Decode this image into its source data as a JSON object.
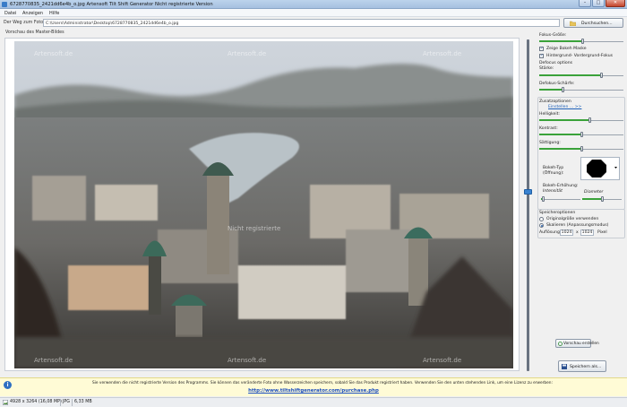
{
  "window": {
    "title": "6728770835_2421dd6e4b_o.jpg Artensoft Tilt Shift Generator  Nicht registrierte Version",
    "controls": [
      "–",
      "□",
      "✕"
    ]
  },
  "menu": [
    "Datei",
    "Anzeigen",
    "Hilfe"
  ],
  "path": {
    "label": "Der Weg zum Foto:",
    "value": "C:\\Users\\Administrator\\Desktop\\6728770835_2421dd6e4b_o.jpg",
    "browse_label": "Durchsuchen..."
  },
  "preview": {
    "label": "Vorschau des Master-Bildes",
    "watermarks": [
      "Artensoft.de",
      "Artensoft.de",
      "Artensoft.de",
      "Nicht registrierte",
      "Artensoft.de",
      "Artensoft.de",
      "Artensoft.de"
    ]
  },
  "panel": {
    "focus_size_label": "Fokus-Größe:",
    "focus_size": 0.52,
    "show_bokeh_mask": "Zeige Bokeh Maske",
    "fg_bg_focus": "Hintergrund- Vordergrund-Fokus",
    "defocus_options_label": "Defocus options",
    "strength_label": "Stärke:",
    "strength": 0.74,
    "defocus_sharpness_label": "Defokus-Schärfe:",
    "defocus_sharpness": 0.28,
    "extra_options_label": "Zusatzoptionen",
    "adjust_link": "Einstellen ... >>",
    "brightness_label": "Helligkeit:",
    "brightness": 0.6,
    "contrast_label": "Kontrast:",
    "contrast": 0.5,
    "saturation_label": "Sättigung:",
    "saturation": 0.5,
    "bokeh_type_label": "Bokeh-Typ",
    "bokeh_opening_label": "(Öffnung):",
    "bokeh_boost_label": "Bokeh-Erhöhung:",
    "intensity_label": "Intensität",
    "diameter_label": "Diameter",
    "bokeh_intensity": 0.05,
    "bokeh_diameter": 0.5,
    "preview_button": "Vorschau erstellen",
    "save_options_label": "Speicheroptionen",
    "original_size": "Originalgröße verwenden",
    "scaling": "Skalieren (Anpassungsmodus)",
    "resolution_label": "Auflösung:",
    "res_w": "1024",
    "res_x": "x",
    "res_h": "1024",
    "res_unit": "Pixel",
    "save_button": "Speichern als..."
  },
  "info": {
    "message": "Sie verwenden die nicht registrierte Version des Programms. Sie können das veränderte Foto ohne Wasserzeichen speichern, sobald Sie das Produkt registriert haben. Verwenden Sie den unten stehenden Link, um eine Lizenz zu erwerben:",
    "url": "http://www.tiltshiftgenerator.com/purchase.php"
  },
  "status": {
    "dimensions": "4928 x 3264 (16,08 MP)",
    "format": "JPG",
    "size": "6,33 MB"
  },
  "colors": {
    "accent": "#3aa23a",
    "link": "#1d4fbf",
    "infobar": "#fffbd6"
  }
}
